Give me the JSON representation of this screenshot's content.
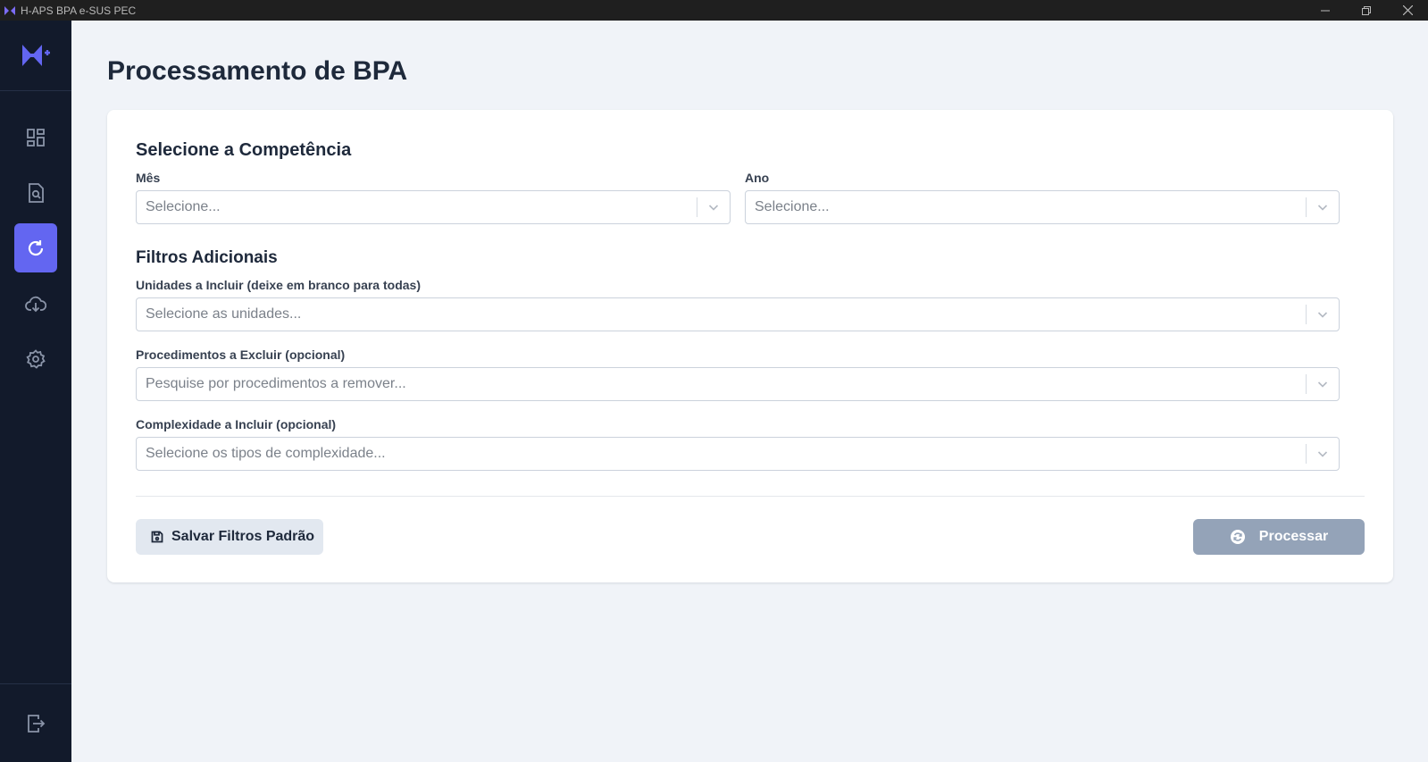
{
  "window": {
    "title": "H-APS BPA e-SUS PEC",
    "icons": {
      "app": "app-logo-icon",
      "minimize": "minimize-icon",
      "maximize": "restore-icon",
      "close": "close-icon"
    }
  },
  "sidebar": {
    "logo": "h-plus-logo",
    "items": [
      {
        "name": "dashboard",
        "icon": "dashboard-icon",
        "active": false
      },
      {
        "name": "search-document",
        "icon": "search-document-icon",
        "active": false
      },
      {
        "name": "processing",
        "icon": "refresh-icon",
        "active": true
      },
      {
        "name": "download",
        "icon": "cloud-download-icon",
        "active": false
      },
      {
        "name": "settings",
        "icon": "gear-icon",
        "active": false
      }
    ],
    "logout_icon": "logout-icon"
  },
  "page": {
    "title": "Processamento de BPA"
  },
  "form": {
    "competencia": {
      "title": "Selecione a Competência",
      "mes": {
        "label": "Mês",
        "placeholder": "Selecione..."
      },
      "ano": {
        "label": "Ano",
        "placeholder": "Selecione..."
      }
    },
    "filtros": {
      "title": "Filtros Adicionais",
      "unidades": {
        "label": "Unidades a Incluir (deixe em branco para todas)",
        "placeholder": "Selecione as unidades..."
      },
      "procedimentos": {
        "label": "Procedimentos a Excluir (opcional)",
        "placeholder": "Pesquise por procedimentos a remover..."
      },
      "complexidade": {
        "label": "Complexidade a Incluir (opcional)",
        "placeholder": "Selecione os tipos de complexidade..."
      }
    }
  },
  "actions": {
    "save_label": "Salvar Filtros Padrão",
    "process_label": "Processar"
  },
  "colors": {
    "accent": "#6366f1",
    "sidebar_bg": "#121a2b",
    "page_bg": "#f0f3f8",
    "process_disabled": "#94a3b8",
    "save_bg": "#e2e8f0"
  }
}
